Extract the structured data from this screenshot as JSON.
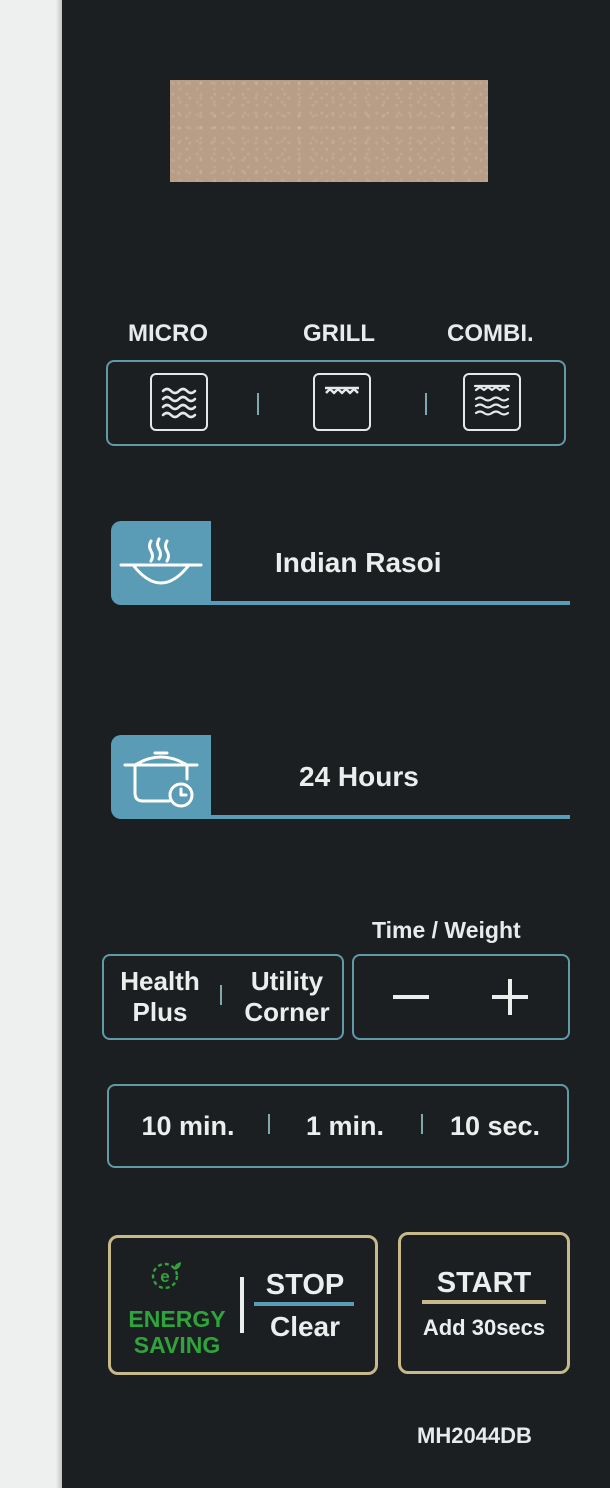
{
  "panel": {
    "model": "MH2044DB"
  },
  "modes": {
    "micro_label": "MICRO",
    "grill_label": "GRILL",
    "combi_label": "COMBI."
  },
  "features": {
    "indian_rasoi": "Indian Rasoi",
    "hours": "24 Hours"
  },
  "time_weight": {
    "label": "Time / Weight",
    "minus": "−",
    "plus": "+"
  },
  "health_plus": {
    "line1": "Health",
    "line2": "Plus"
  },
  "utility_corner": {
    "line1": "Utility",
    "line2": "Corner"
  },
  "time_buttons": {
    "ten_min": "10 min.",
    "one_min": "1 min.",
    "ten_sec": "10 sec."
  },
  "energy": {
    "line1": "ENERGY",
    "line2": "SAVING",
    "icon_letter": "e"
  },
  "stop": {
    "top": "STOP",
    "bottom": "Clear"
  },
  "start": {
    "top": "START",
    "bottom": "Add 30secs"
  },
  "colors": {
    "panel": "#1b1f22",
    "accent_blue": "#5a9bb6",
    "outline": "#5f9aa7",
    "gold": "#c8b98a",
    "energy_green": "#2fa43a"
  }
}
